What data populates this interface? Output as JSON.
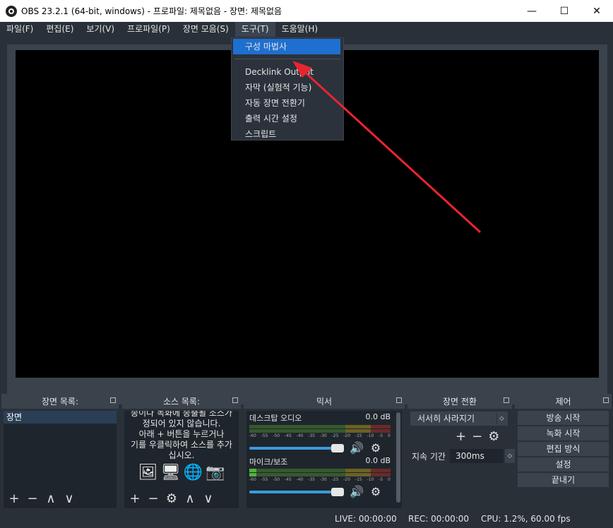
{
  "window": {
    "title": "OBS 23.2.1 (64-bit, windows) - 프로파일: 제목없음 - 장면: 제목없음",
    "minimize_glyph": "—",
    "maximize_glyph": "☐",
    "close_glyph": "✕"
  },
  "menu": {
    "items": [
      "파일(F)",
      "편집(E)",
      "보기(V)",
      "프로파일(P)",
      "장면 모음(S)",
      "도구(T)",
      "도움말(H)"
    ]
  },
  "tools_menu": {
    "items": [
      "구성 마법사",
      "Decklink Output",
      "자막 (실험적 기능)",
      "자동 장면 전환기",
      "출력 시간 설정",
      "스크립트"
    ]
  },
  "docks": {
    "scenes": {
      "title": "장면 목록:",
      "items": [
        "장면"
      ]
    },
    "sources": {
      "title": "소스 목록:",
      "empty_text": [
        "송이나 녹화에 송출될 소스가",
        "정되어 있지 않습니다.",
        "아래 + 버튼을 누르거나",
        "기를 우클릭하여 소스를 추가",
        "십시오."
      ]
    },
    "mixer": {
      "title": "믹서",
      "channels": [
        {
          "name": "데스크탑 오디오",
          "level": "0.0 dB"
        },
        {
          "name": "마이크/보조",
          "level": "0.0 dB"
        }
      ],
      "ticks": [
        "-60",
        "-55",
        "-50",
        "-45",
        "-40",
        "-35",
        "-30",
        "-25",
        "-20",
        "-15",
        "-10",
        "-5",
        "0"
      ]
    },
    "transitions": {
      "title": "장면 전환",
      "selected": "서서히 사라지기",
      "duration_label": "지속 기간",
      "duration_value": "300ms"
    },
    "controls": {
      "title": "제어",
      "buttons": [
        "방송 시작",
        "녹화 시작",
        "편집 방식",
        "설정",
        "끝내기"
      ]
    }
  },
  "status": {
    "live": "LIVE: 00:00:00",
    "rec": "REC: 00:00:00",
    "cpu": "CPU: 1.2%, 60.00 fps"
  },
  "colors": {
    "accent": "#1f6fd0",
    "annotation_arrow": "#e8252f"
  }
}
